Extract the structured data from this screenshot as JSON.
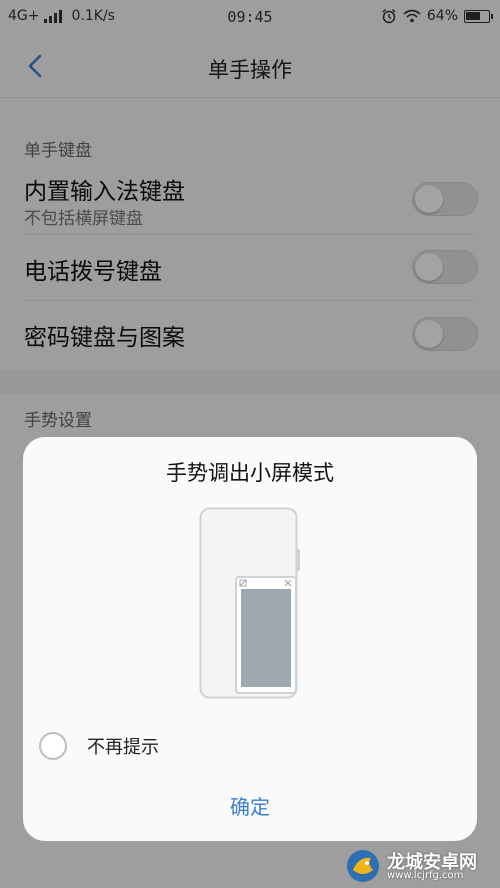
{
  "status_bar": {
    "network": "4G+",
    "speed": "0.1K/s",
    "time": "09:45",
    "battery": "64%"
  },
  "header": {
    "title": "单手操作"
  },
  "sections": [
    {
      "label": "单手键盘",
      "items": [
        {
          "title": "内置输入法键盘",
          "subtitle": "不包括横屏键盘",
          "enabled": false
        },
        {
          "title": "电话拨号键盘",
          "enabled": false
        },
        {
          "title": "密码键盘与图案",
          "enabled": false
        }
      ]
    },
    {
      "label": "手势设置"
    }
  ],
  "dialog": {
    "title": "手势调出小屏模式",
    "dont_remind_label": "不再提示",
    "dont_remind_checked": false,
    "confirm_label": "确定"
  },
  "watermark": {
    "name": "龙城安卓网",
    "url": "www.lcjrfg.com"
  },
  "colors": {
    "accent": "#3a7fd0",
    "background": "#f7f7f7",
    "toggle_off": "#e3e3e3"
  },
  "icons": {
    "back": "chevron-left-icon",
    "alarm": "alarm-icon",
    "wifi": "wifi-icon",
    "battery": "battery-icon"
  }
}
